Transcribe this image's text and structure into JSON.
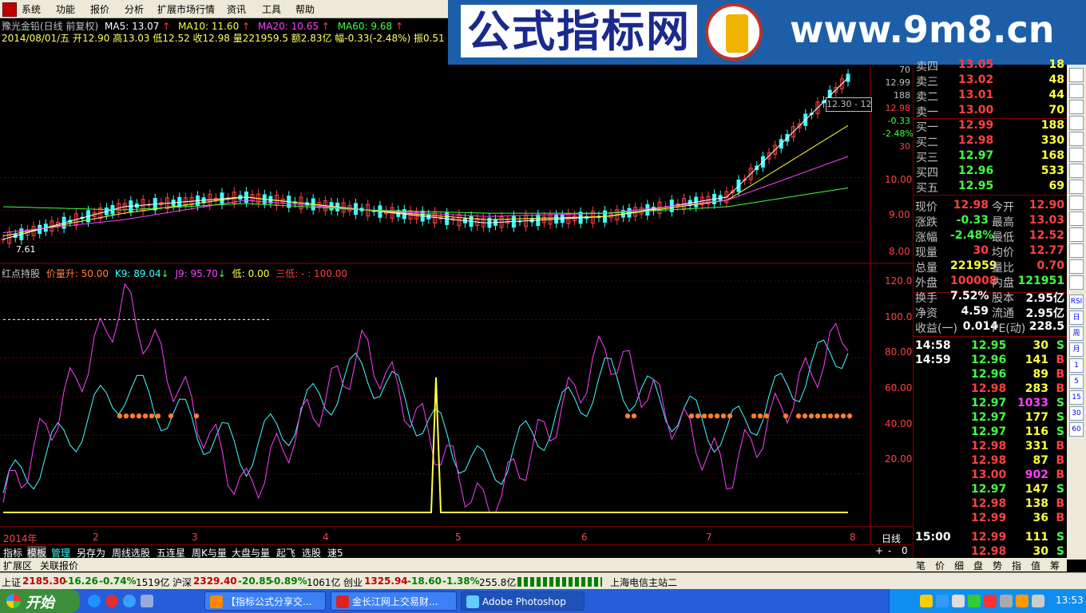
{
  "menu": [
    "系统",
    "功能",
    "报价",
    "分析",
    "扩展市场行情",
    "资讯",
    "工具",
    "帮助"
  ],
  "banner": {
    "brand": "公式指标网",
    "url": "www.9m8.cn"
  },
  "stock_header": {
    "name": "豫光金铅(日线 前复权)",
    "ma5": "MA5: 13.07",
    "ma10": "MA10: 11.60",
    "ma20": "MA20: 10.65",
    "ma60": "MA60: 9.68",
    "ohlc": "2014/08/01/五 开12.90 高13.03 低12.52 收12.98 量221959.5 额2.83亿 幅-0.33(-2.48%) 振0.51(3.83%)"
  },
  "indicator_header": {
    "name": "红点持股",
    "p1": "价量升: 50.00",
    "p2": "K9: 89.04",
    "p3": "J9: 95.70",
    "p4": "低: 0.00",
    "p5": "三低: - : 100.00"
  },
  "price_axis": [
    "10.00",
    "9.00",
    "8.00"
  ],
  "price_axis_top": [
    "70",
    "12.99",
    "188",
    "12.98",
    "-0.33",
    "-2.48%",
    "30"
  ],
  "tooltip": "12.30 - 12",
  "price_low_label": "7.61",
  "ind_axis": [
    "120.0",
    "100.0",
    "80.00",
    "60.00",
    "40.00",
    "20.00"
  ],
  "x_labels": [
    "2014年",
    "2",
    "3",
    "4",
    "5",
    "6",
    "7",
    "8"
  ],
  "period_label": "日线",
  "zoom_buttons": [
    "+",
    "-",
    "0"
  ],
  "chart_data": [
    {
      "type": "line",
      "title": "豫光金铅(日线 前复权)",
      "x": [
        "2014-01",
        "2014-02",
        "2014-03",
        "2014-04",
        "2014-05",
        "2014-06",
        "2014-07",
        "2014-08"
      ],
      "series": [
        {
          "name": "MA5",
          "values": [
            8.1,
            9.1,
            9.4,
            9.0,
            8.6,
            8.8,
            9.4,
            13.07
          ]
        },
        {
          "name": "MA10",
          "values": [
            8.2,
            8.9,
            9.4,
            9.0,
            8.7,
            8.8,
            9.3,
            11.6
          ]
        },
        {
          "name": "MA20",
          "values": [
            8.3,
            8.7,
            9.3,
            9.0,
            8.8,
            8.9,
            9.3,
            10.65
          ]
        },
        {
          "name": "MA60",
          "values": [
            9.1,
            9.0,
            9.2,
            9.0,
            8.9,
            8.9,
            9.1,
            9.68
          ]
        }
      ],
      "ylim": [
        7.6,
        13.5
      ]
    },
    {
      "type": "line",
      "title": "红点持股",
      "x": [
        "2014-01",
        "2014-02",
        "2014-03",
        "2014-04",
        "2014-05",
        "2014-06",
        "2014-07",
        "2014-08"
      ],
      "series": [
        {
          "name": "K9",
          "values": [
            10,
            65,
            30,
            75,
            20,
            70,
            40,
            89.04
          ]
        },
        {
          "name": "J9",
          "values": [
            5,
            110,
            10,
            85,
            0,
            85,
            20,
            95.7
          ]
        }
      ],
      "ylim": [
        0,
        120
      ]
    }
  ],
  "order_book": [
    {
      "label": "卖四",
      "price": "13.05",
      "vol": "18"
    },
    {
      "label": "卖三",
      "price": "13.02",
      "vol": "48"
    },
    {
      "label": "卖二",
      "price": "13.01",
      "vol": "44"
    },
    {
      "label": "卖一",
      "price": "13.00",
      "vol": "70"
    },
    {
      "label": "买一",
      "price": "12.99",
      "vol": "188"
    },
    {
      "label": "买二",
      "price": "12.98",
      "vol": "330"
    },
    {
      "label": "买三",
      "price": "12.97",
      "vol": "168"
    },
    {
      "label": "买四",
      "price": "12.96",
      "vol": "533"
    },
    {
      "label": "买五",
      "price": "12.95",
      "vol": "69"
    }
  ],
  "stats": [
    {
      "k1": "现价",
      "v1": "12.98",
      "k2": "今开",
      "v2": "12.90"
    },
    {
      "k1": "涨跌",
      "v1": "-0.33",
      "k2": "最高",
      "v2": "13.03"
    },
    {
      "k1": "涨幅",
      "v1": "-2.48%",
      "k2": "最低",
      "v2": "12.52"
    },
    {
      "k1": "现量",
      "v1": "30",
      "k2": "均价",
      "v2": "12.77"
    },
    {
      "k1": "总量",
      "v1": "221959",
      "k2": "量比",
      "v2": "0.70"
    },
    {
      "k1": "外盘",
      "v1": "100008",
      "k2": "内盘",
      "v2": "121951"
    },
    {
      "k1": "换手",
      "v1": "7.52%",
      "k2": "股本",
      "v2": "2.95亿"
    },
    {
      "k1": "净资",
      "v1": "4.59",
      "k2": "流通",
      "v2": "2.95亿"
    },
    {
      "k1": "收益(一)",
      "v1": "0.014",
      "k2": "PE(动)",
      "v2": "228.5"
    }
  ],
  "ticks": [
    {
      "t": "14:58",
      "p": "12.95",
      "v": "30",
      "s": "S"
    },
    {
      "t": "14:59",
      "p": "12.96",
      "v": "141",
      "s": "B"
    },
    {
      "t": "",
      "p": "12.96",
      "v": "89",
      "s": "B"
    },
    {
      "t": "",
      "p": "12.98",
      "v": "283",
      "s": "B"
    },
    {
      "t": "",
      "p": "12.97",
      "v": "1033",
      "s": "S"
    },
    {
      "t": "",
      "p": "12.97",
      "v": "177",
      "s": "S"
    },
    {
      "t": "",
      "p": "12.97",
      "v": "116",
      "s": "S"
    },
    {
      "t": "",
      "p": "12.98",
      "v": "331",
      "s": "B"
    },
    {
      "t": "",
      "p": "12.98",
      "v": "87",
      "s": "B"
    },
    {
      "t": "",
      "p": "13.00",
      "v": "902",
      "s": "B"
    },
    {
      "t": "",
      "p": "12.97",
      "v": "147",
      "s": "S"
    },
    {
      "t": "",
      "p": "12.98",
      "v": "138",
      "s": "B"
    },
    {
      "t": "",
      "p": "12.99",
      "v": "36",
      "s": "B"
    },
    {
      "t": "15:00",
      "p": "12.99",
      "v": "111",
      "s": "S"
    },
    {
      "t": "",
      "p": "12.98",
      "v": "30",
      "s": "S"
    }
  ],
  "bottom_tabs": [
    "指标",
    "模板",
    "管理",
    "另存为",
    "周线选股",
    "五连星",
    "周K与量",
    "大盘与量",
    "起飞",
    "选股",
    "速5"
  ],
  "bottom_tabs2": [
    "扩展区",
    "关联报价"
  ],
  "quote_tabs": [
    "笔",
    "价",
    "细",
    "盘",
    "势",
    "指",
    "值",
    "筹"
  ],
  "status": {
    "sh_label": "上证",
    "sh_val": "2185.30",
    "sh_chg": "-16.26",
    "sh_pct": "-0.74%",
    "sh_amt": "1519亿",
    "sz_label": "沪深",
    "sz_val": "2329.40",
    "sz_chg": "-20.85",
    "sz_pct": "-0.89%",
    "sz_amt": "1061亿",
    "cy_label": "创业",
    "cy_val": "1325.94",
    "cy_chg": "-18.60",
    "cy_pct": "-1.38%",
    "cy_amt": "255.8亿",
    "server": "上海电信主站二"
  },
  "taskbar": {
    "start": "开始",
    "tasks": [
      "【指标公式分享交...",
      "金长江网上交易财...",
      "Adobe Photoshop"
    ],
    "clock": "13:53"
  },
  "right_tools": [
    "RSI",
    "日",
    "周",
    "月",
    "1",
    "5",
    "15",
    "30",
    "60"
  ]
}
